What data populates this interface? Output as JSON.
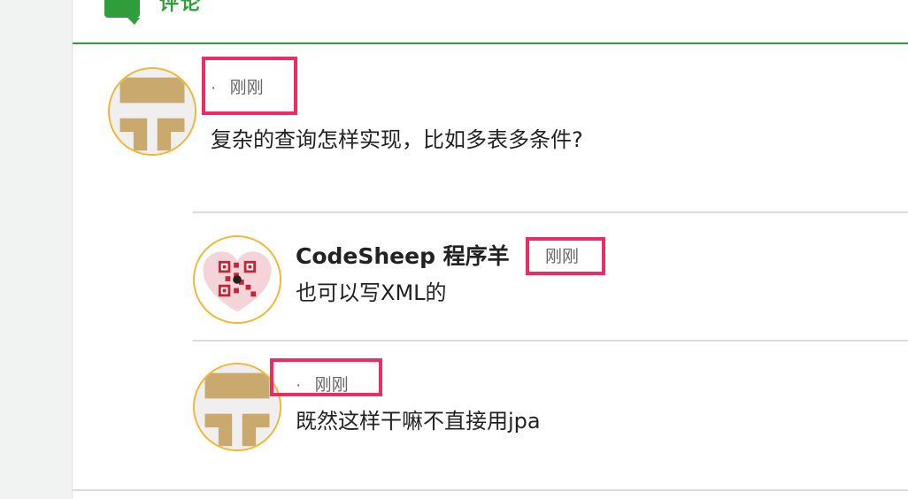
{
  "section": {
    "title": "评论"
  },
  "comments": [
    {
      "dot": "·",
      "time": "刚刚",
      "content": "复杂的查询怎样实现，比如多表多条件?"
    }
  ],
  "replies": [
    {
      "author": "CodeSheep 程序羊",
      "time": "刚刚",
      "content": "也可以写XML的"
    },
    {
      "dot": "·",
      "time": "刚刚",
      "content": "既然这样干嘛不直接用jpa"
    }
  ],
  "colors": {
    "accent_green": "#2f9e3a",
    "highlight_pink": "#ee2b63",
    "avatar_border": "#f2b632",
    "avatar_tan": "#c9a96e"
  }
}
